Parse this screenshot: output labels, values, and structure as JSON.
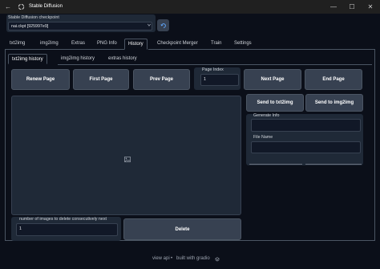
{
  "window": {
    "title": "Stable Diffusion",
    "back_glyph": "←",
    "minimize_glyph": "—",
    "maximize_glyph": "☐",
    "close_glyph": "✕"
  },
  "checkpoint": {
    "label": "Stable Diffusion checkpoint",
    "value": "nai.ckpt [925997e9]"
  },
  "tabs": [
    {
      "label": "txt2img"
    },
    {
      "label": "img2img"
    },
    {
      "label": "Extras"
    },
    {
      "label": "PNG Info"
    },
    {
      "label": "History"
    },
    {
      "label": "Checkpoint Merger"
    },
    {
      "label": "Train"
    },
    {
      "label": "Settings"
    }
  ],
  "subtabs": [
    {
      "label": "txt2img history"
    },
    {
      "label": "img2img history"
    },
    {
      "label": "extras history"
    }
  ],
  "nav": {
    "renew": "Renew Page",
    "first": "First Page",
    "prev": "Prev Page",
    "page_index_label": "Page Index",
    "page_index_value": "1",
    "next": "Next Page",
    "end": "End Page"
  },
  "send": {
    "txt2img": "Send to txt2img",
    "img2img": "Send to img2img"
  },
  "info": {
    "generate_label": "Generate Info",
    "file_name_label": "File Name"
  },
  "delete": {
    "count_label": "number of images to delete consecutively next",
    "count_value": "1",
    "button": "Delete"
  },
  "footer": {
    "view_api": "view api",
    "separator": "•",
    "built_with": "built with gradio"
  }
}
